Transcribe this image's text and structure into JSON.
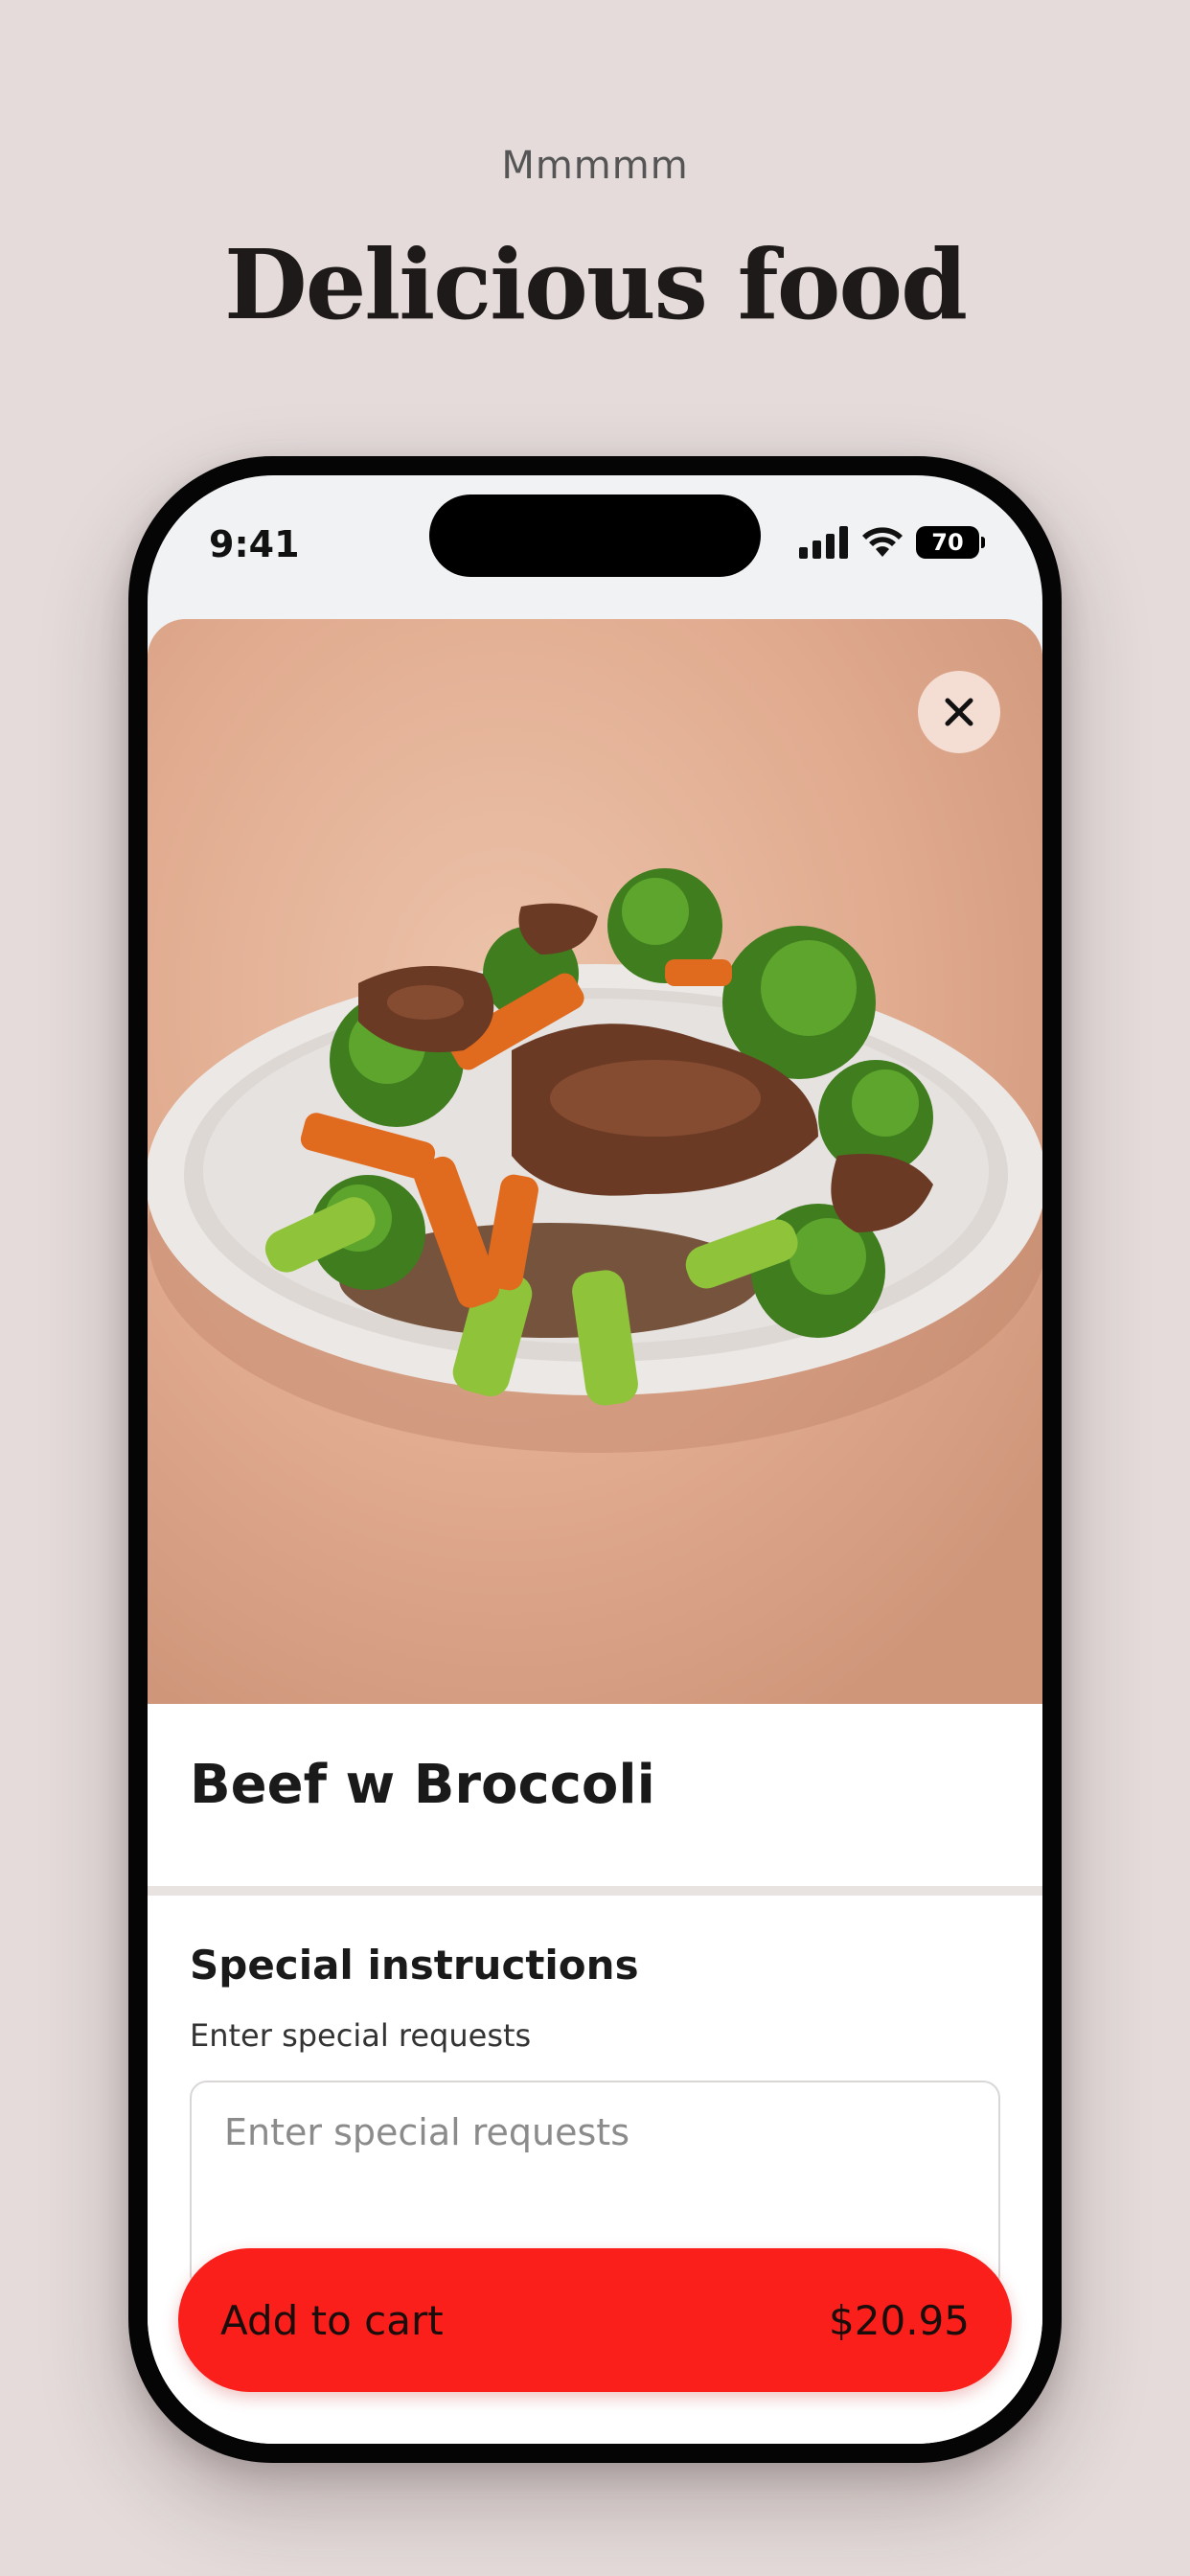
{
  "header": {
    "subtitle": "Mmmmm",
    "title": "Delicious food"
  },
  "status_bar": {
    "time": "9:41",
    "battery": "70",
    "icons": [
      "signal-icon",
      "wifi-icon",
      "battery-icon"
    ]
  },
  "item": {
    "name": "Beef w Broccoli",
    "image_alt": "Beef with broccoli and carrots on a white plate"
  },
  "instructions": {
    "title": "Special instructions",
    "label": "Enter special requests",
    "placeholder": "Enter special requests"
  },
  "cart_button": {
    "label": "Add to cart",
    "price": "$20.95"
  },
  "colors": {
    "background": "#e4dbda",
    "accent": "#fa1f1a",
    "close_button": "#f4ddd2"
  }
}
